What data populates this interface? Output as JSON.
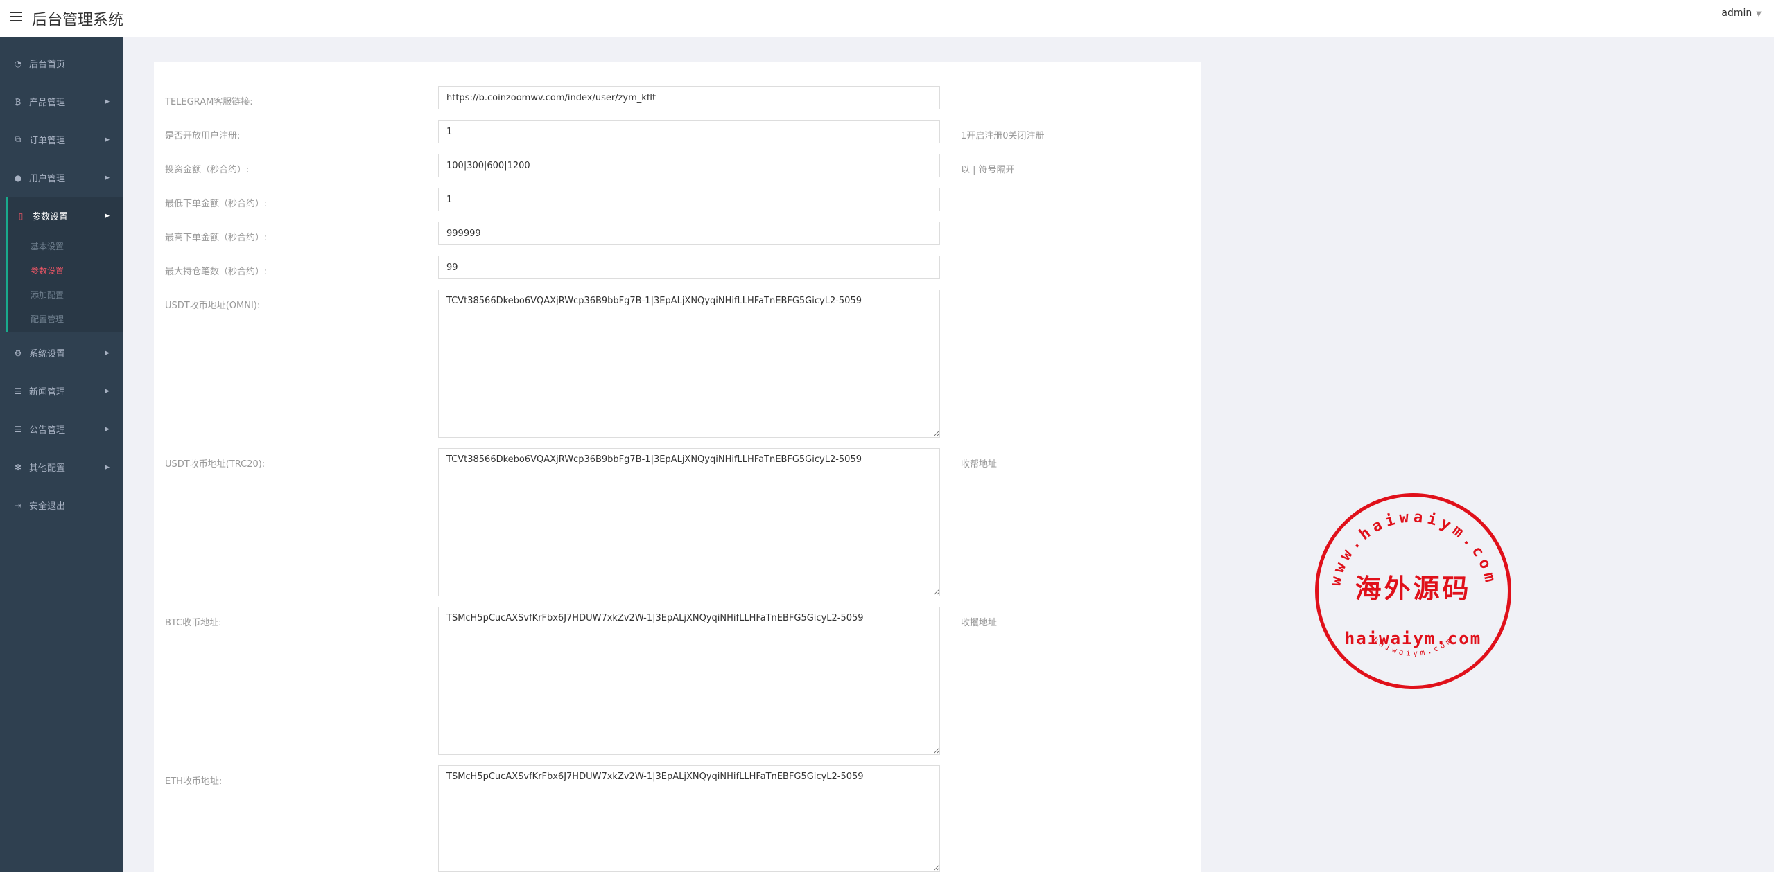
{
  "header": {
    "title": "后台管理系统",
    "user": "admin"
  },
  "sidebar": {
    "items": [
      {
        "label": "后台首页",
        "icon": "dashboard-icon",
        "arrow": false
      },
      {
        "label": "产品管理",
        "icon": "bitcoin-icon",
        "arrow": true
      },
      {
        "label": "订单管理",
        "icon": "copy-icon",
        "arrow": true
      },
      {
        "label": "用户管理",
        "icon": "user-icon",
        "arrow": true
      }
    ],
    "active": {
      "label": "参数设置",
      "icon": "file-icon",
      "subitems": [
        "基本设置",
        "参数设置",
        "添加配置",
        "配置管理"
      ],
      "current": 1
    },
    "items_after": [
      {
        "label": "系统设置",
        "icon": "gears-icon",
        "arrow": true
      },
      {
        "label": "新闻管理",
        "icon": "list-icon",
        "arrow": true
      },
      {
        "label": "公告管理",
        "icon": "list-icon",
        "arrow": true
      },
      {
        "label": "其他配置",
        "icon": "gear-icon",
        "arrow": true
      },
      {
        "label": "安全退出",
        "icon": "sign-out-icon",
        "arrow": false
      }
    ]
  },
  "form": {
    "rows": [
      {
        "label": "TELEGRAM客服链接:",
        "value": "https://b.coinzoomwv.com/index/user/zym_kflt",
        "hint": ""
      },
      {
        "label": "是否开放用户注册:",
        "value": "1",
        "hint": "1开启注册0关闭注册"
      },
      {
        "label": "投资金额（秒合约）:",
        "value": "100|300|600|1200",
        "hint": "以 | 符号隔开"
      },
      {
        "label": "最低下单金额（秒合约）:",
        "value": "1",
        "hint": ""
      },
      {
        "label": "最高下单金额（秒合约）:",
        "value": "999999",
        "hint": ""
      },
      {
        "label": "最大持仓笔数（秒合约）:",
        "value": "99",
        "hint": ""
      }
    ],
    "textareas": [
      {
        "label": "USDT收币地址(OMNI):",
        "value": "TCVt38566Dkebo6VQAXjRWcp36B9bbFg7B-1|3EpALjXNQyqiNHifLLHFaTnEBFG5GicyL2-5059",
        "hint": ""
      },
      {
        "label": "USDT收币地址(TRC20):",
        "value": "TCVt38566Dkebo6VQAXjRWcp36B9bbFg7B-1|3EpALjXNQyqiNHifLLHFaTnEBFG5GicyL2-5059",
        "hint": "收帮地址"
      },
      {
        "label": "BTC收币地址:",
        "value": "TSMcH5pCucAXSvfKrFbx6J7HDUW7xkZv2W-1|3EpALjXNQyqiNHifLLHFaTnEBFG5GicyL2-5059",
        "hint": "收攫地址"
      },
      {
        "label": "ETH收币地址:",
        "value": "TSMcH5pCucAXSvfKrFbx6J7HDUW7xkZv2W-1|3EpALjXNQyqiNHifLLHFaTnEBFG5GicyL2-5059",
        "hint": ""
      }
    ]
  },
  "watermark": {
    "arc_text": "www.haiwaiym.com",
    "center_text": "海外源码",
    "domain_text": "haiwaiym.com",
    "small_text": "haiwaiym.com",
    "color": "#e0101a"
  }
}
